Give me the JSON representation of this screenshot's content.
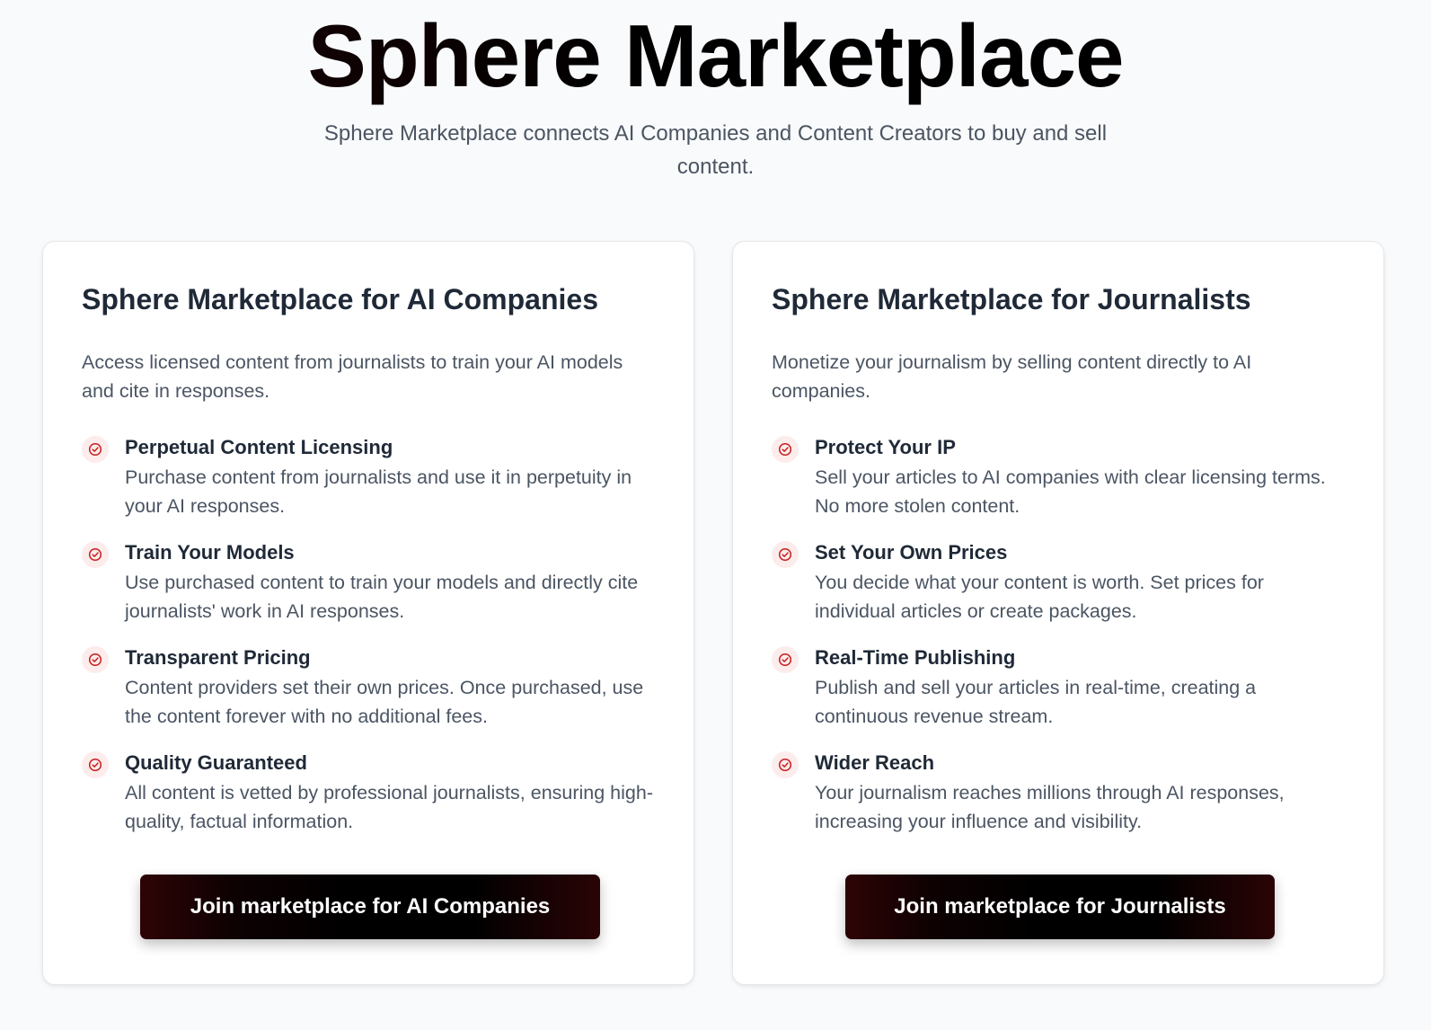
{
  "hero": {
    "title": "Sphere Marketplace",
    "subtitle": "Sphere Marketplace connects AI Companies and Content Creators to buy and sell content."
  },
  "accent_color": "#c81e1e",
  "cards": [
    {
      "title": "Sphere Marketplace for AI Companies",
      "description": "Access licensed content from journalists to train your AI models and cite in responses.",
      "features": [
        {
          "icon": "check-circle-icon",
          "title": "Perpetual Content Licensing",
          "description": "Purchase content from journalists and use it in perpetuity in your AI responses."
        },
        {
          "icon": "check-circle-icon",
          "title": "Train Your Models",
          "description": "Use purchased content to train your models and directly cite journalists' work in AI responses."
        },
        {
          "icon": "check-circle-icon",
          "title": "Transparent Pricing",
          "description": "Content providers set their own prices. Once purchased, use the content forever with no additional fees."
        },
        {
          "icon": "check-circle-icon",
          "title": "Quality Guaranteed",
          "description": "All content is vetted by professional journalists, ensuring high-quality, factual information."
        }
      ],
      "button_label": "Join marketplace for AI Companies"
    },
    {
      "title": "Sphere Marketplace for Journalists",
      "description": "Monetize your journalism by selling content directly to AI companies.",
      "features": [
        {
          "icon": "check-circle-icon",
          "title": "Protect Your IP",
          "description": "Sell your articles to AI companies with clear licensing terms. No more stolen content."
        },
        {
          "icon": "check-circle-icon",
          "title": "Set Your Own Prices",
          "description": "You decide what your content is worth. Set prices for individual articles or create packages."
        },
        {
          "icon": "check-circle-icon",
          "title": "Real-Time Publishing",
          "description": "Publish and sell your articles in real-time, creating a continuous revenue stream."
        },
        {
          "icon": "check-circle-icon",
          "title": "Wider Reach",
          "description": "Your journalism reaches millions through AI responses, increasing your influence and visibility."
        }
      ],
      "button_label": "Join marketplace for Journalists"
    }
  ]
}
